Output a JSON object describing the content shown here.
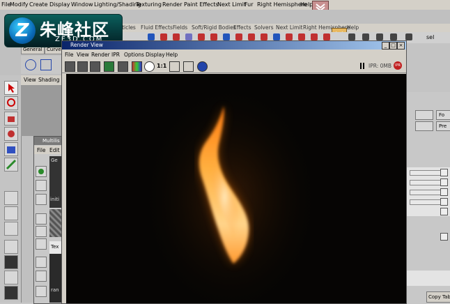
{
  "main_menu": [
    "File",
    "Modify",
    "Create",
    "Display",
    "Window",
    "Lighting/Shading",
    "Texturing",
    "Render",
    "Paint Effects",
    "Next Limit",
    "Fur",
    "Right Hemisphere",
    "Help"
  ],
  "sub_menu": [
    "rticles",
    "Fluid Effects",
    "Fields",
    "Soft/Rigid Bodies",
    "Effects",
    "Solvers",
    "Next Limit",
    "Right Hemisphere",
    "Help"
  ],
  "shelf_tabs": [
    "General",
    "Curves"
  ],
  "panel_menu": [
    "View",
    "Shading"
  ],
  "logo": {
    "cn": "朱峰社区",
    "en": "ZF3D.COM",
    "mark": "Z"
  },
  "render_view": {
    "title": "Render View",
    "menu": [
      "File",
      "View",
      "Render",
      "IPR",
      "Options",
      "Display",
      "Help"
    ],
    "ratio_label": "1:1",
    "ipr_status": "IPR: 0MB",
    "ipr_badge": "IPR"
  },
  "outliner": {
    "title": "Multilis",
    "menu": [
      "File",
      "Edit"
    ],
    "label_ge": "Ge",
    "label_init": "initi",
    "label_tex": "Tex",
    "label_ran": "ran"
  },
  "right_panel": {
    "btn1": "Fo",
    "btn2": "Pre",
    "sel_label": "sel",
    "copy_tab": "Copy Tab"
  },
  "colors": {
    "render_bg": "#060504",
    "flame_core": "#ffd48a",
    "flame_edge": "#ff7a10",
    "title_blue": "#0a246a"
  }
}
